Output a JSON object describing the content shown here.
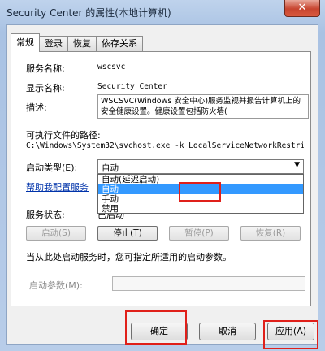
{
  "window": {
    "title": "Security Center 的属性(本地计算机)",
    "close_label": "✕"
  },
  "tabs": [
    {
      "label": "常规"
    },
    {
      "label": "登录"
    },
    {
      "label": "恢复"
    },
    {
      "label": "依存关系"
    }
  ],
  "general": {
    "service_name_label": "服务名称:",
    "service_name_value": "wscsvc",
    "display_name_label": "显示名称:",
    "display_name_value": "Security Center",
    "description_label": "描述:",
    "description_value": "WSCSVC(Windows 安全中心)服务监视并报告计算机上的安全健康设置。健康设置包括防火墙(",
    "exec_path_label": "可执行文件的路径:",
    "exec_path_value": "C:\\Windows\\System32\\svchost.exe -k LocalServiceNetworkRestri",
    "startup_type_label": "启动类型(E):",
    "startup_type_value": "自动",
    "startup_options": [
      "自动(延迟启动)",
      "自动",
      "手动",
      "禁用"
    ],
    "help_link": "帮助我配置服务",
    "service_status_label": "服务状态:",
    "service_status_value": "已启动",
    "start_button": "启动(S)",
    "stop_button": "停止(T)",
    "pause_button": "暂停(P)",
    "resume_button": "恢复(R)",
    "hint_text": "当从此处启动服务时，您可指定所适用的启动参数。",
    "start_params_label": "启动参数(M):",
    "start_params_value": ""
  },
  "dialog_buttons": {
    "ok": "确定",
    "cancel": "取消",
    "apply": "应用(A)"
  },
  "colors": {
    "highlight": "#e0201a",
    "selection": "#3399ff",
    "link": "#0033aa"
  }
}
